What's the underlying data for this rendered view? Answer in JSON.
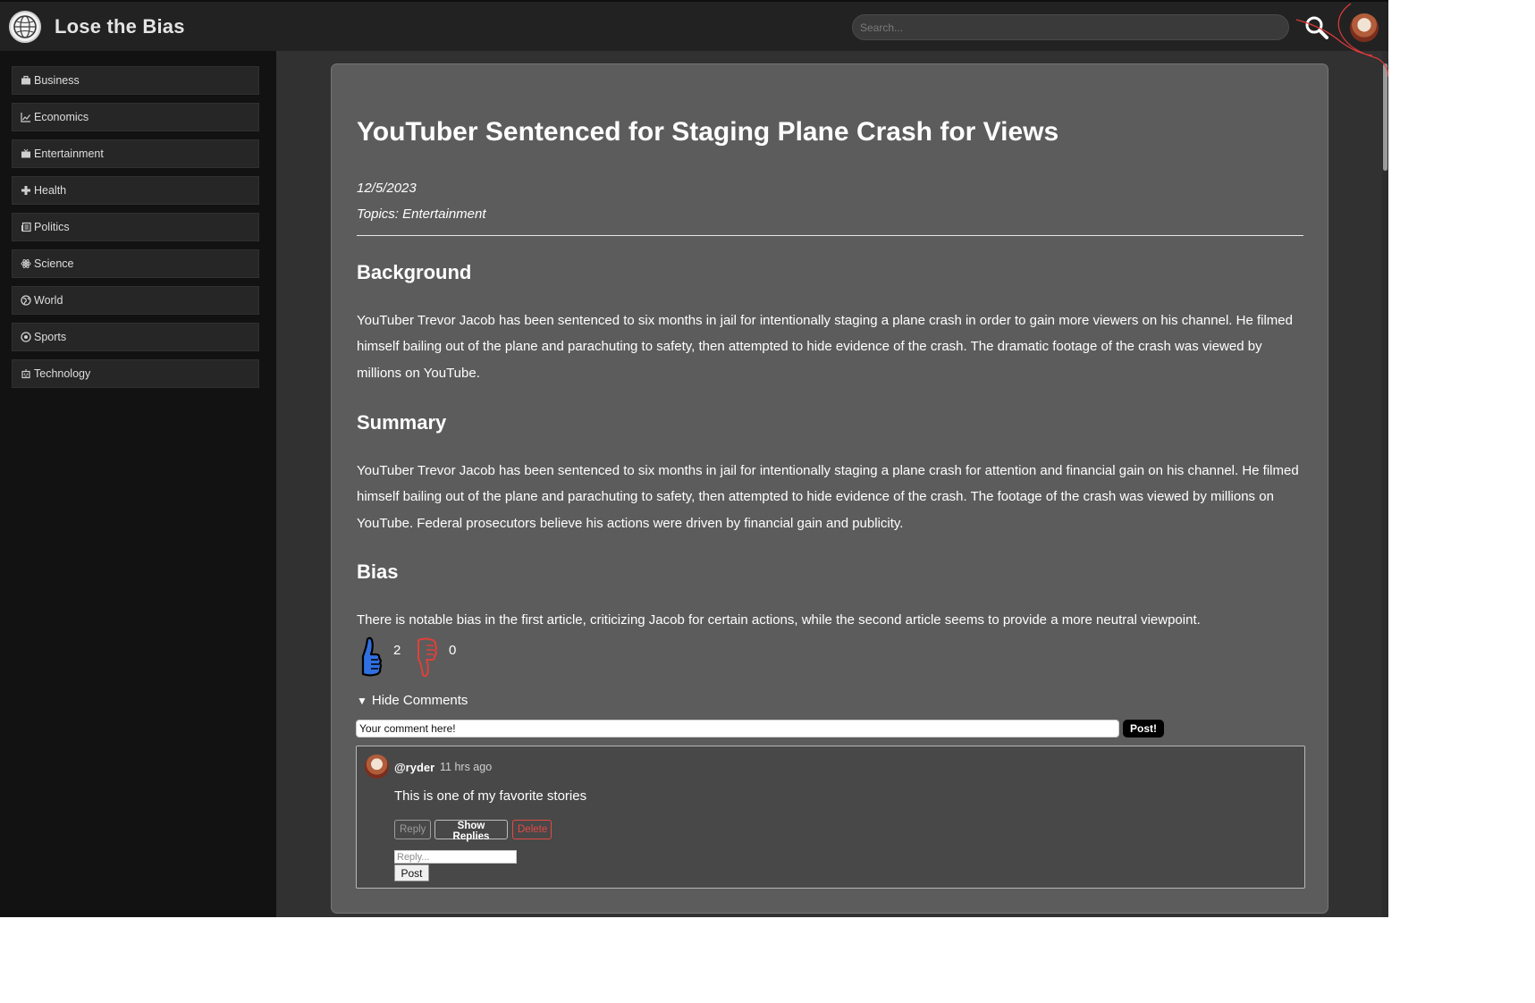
{
  "header": {
    "site_title": "Lose the Bias",
    "logo_icon": "globe-logo-icon",
    "search_placeholder": "Search...",
    "search_icon": "search-icon",
    "avatar_icon": "user-avatar-icon"
  },
  "sidebar": {
    "items": [
      {
        "label": "Business",
        "icon": "briefcase-icon"
      },
      {
        "label": "Economics",
        "icon": "line-chart-icon"
      },
      {
        "label": "Entertainment",
        "icon": "tv-icon"
      },
      {
        "label": "Health",
        "icon": "plus-icon"
      },
      {
        "label": "Politics",
        "icon": "newspaper-icon"
      },
      {
        "label": "Science",
        "icon": "atom-icon"
      },
      {
        "label": "World",
        "icon": "globe-icon"
      },
      {
        "label": "Sports",
        "icon": "ball-icon"
      },
      {
        "label": "Technology",
        "icon": "robot-icon"
      }
    ]
  },
  "article": {
    "title": "YouTuber Sentenced for Staging Plane Crash for Views",
    "date": "12/5/2023",
    "topics": "Topics: Entertainment",
    "background_heading": "Background",
    "background_text": "YouTuber Trevor Jacob has been sentenced to six months in jail for intentionally staging a plane crash in order to gain more viewers on his channel. He filmed himself bailing out of the plane and parachuting to safety, then attempted to hide evidence of the crash. The dramatic footage of the crash was viewed by millions on YouTube.",
    "summary_heading": "Summary",
    "summary_text": "YouTuber Trevor Jacob has been sentenced to six months in jail for intentionally staging a plane crash for attention and financial gain on his channel. He filmed himself bailing out of the plane and parachuting to safety, then attempted to hide evidence of the crash. The footage of the crash was viewed by millions on YouTube. Federal prosecutors believe his actions were driven by financial gain and publicity.",
    "bias_heading": "Bias",
    "bias_text": "There is notable bias in the first article, criticizing Jacob for certain actions, while the second article seems to provide a more neutral viewpoint.",
    "likes": "2",
    "dislikes": "0",
    "like_color": "#2f6fe0",
    "dislike_color": "#e0403a"
  },
  "comments": {
    "toggle_label": "Hide Comments",
    "input_placeholder": "Your comment here!",
    "post_label": "Post!",
    "items": [
      {
        "user": "@ryder",
        "time": "11 hrs ago",
        "text": "This is one of my favorite stories",
        "reply_label": "Reply",
        "show_replies_label": "Show Replies",
        "delete_label": "Delete",
        "reply_placeholder": "Reply...",
        "reply_post_label": "Post"
      }
    ]
  }
}
